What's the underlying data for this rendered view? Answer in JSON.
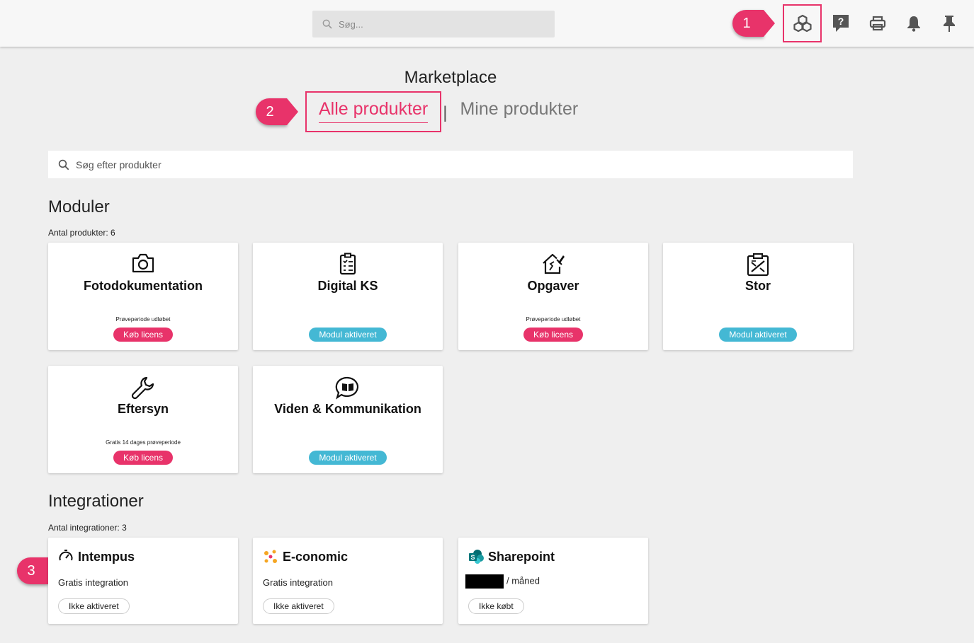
{
  "header": {
    "search_placeholder": "Søg...",
    "icons": [
      "marketplace-icon",
      "help-icon",
      "print-icon",
      "bell-icon",
      "pin-icon"
    ]
  },
  "callouts": [
    "1",
    "2",
    "3"
  ],
  "page": {
    "title": "Marketplace",
    "tabs": {
      "all": "Alle produkter",
      "separator": "|",
      "mine": "Mine produkter"
    },
    "search_placeholder": "Søg efter produkter"
  },
  "modules": {
    "title": "Moduler",
    "count": "Antal produkter: 6",
    "items": [
      {
        "name": "Fotodokumentation",
        "icon": "camera-icon",
        "note": "Prøveperiode udløbet",
        "badge": "Køb licens",
        "status": "buy"
      },
      {
        "name": "Digital KS",
        "icon": "clipboard-check-icon",
        "note": "",
        "badge": "Modul aktiveret",
        "status": "active"
      },
      {
        "name": "Opgaver",
        "icon": "house-tools-icon",
        "note": "Prøveperiode udløbet",
        "badge": "Køb licens",
        "status": "buy"
      },
      {
        "name": "Stor",
        "icon": "clipboard-tools-icon",
        "note": "",
        "badge": "Modul aktiveret",
        "status": "active"
      },
      {
        "name": "Eftersyn",
        "icon": "wrench-icon",
        "note": "Gratis 14 dages prøveperiode",
        "badge": "Køb licens",
        "status": "buy"
      },
      {
        "name": "Viden & Kommunikation",
        "icon": "book-chat-icon",
        "note": "",
        "badge": "Modul aktiveret",
        "status": "active"
      }
    ]
  },
  "integrations": {
    "title": "Integrationer",
    "count": "Antal integrationer: 3",
    "items": [
      {
        "name": "Intempus",
        "icon": "stopwatch-icon",
        "sub": "Gratis integration",
        "pill": "Ikke aktiveret"
      },
      {
        "name": "E-conomic",
        "icon": "economic-logo-icon",
        "sub": "Gratis integration",
        "pill": "Ikke aktiveret"
      },
      {
        "name": "Sharepoint",
        "icon": "sharepoint-logo-icon",
        "sub": "/ måned",
        "pill": "Ikke købt"
      }
    ]
  },
  "colors": {
    "accent": "#e8336a",
    "active": "#44b8d4",
    "background": "#efefef"
  }
}
